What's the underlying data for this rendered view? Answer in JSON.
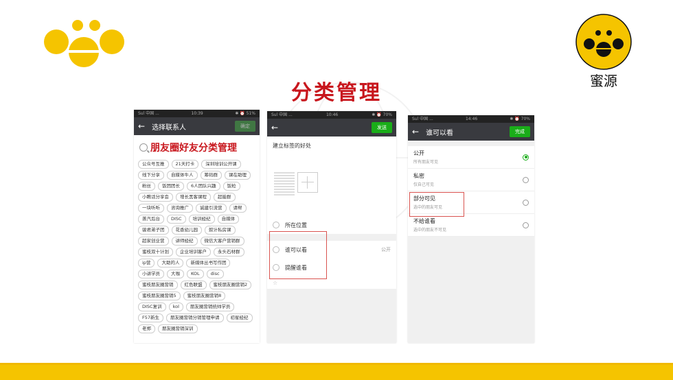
{
  "brand": {
    "name": "蜜源",
    "accent": "#f5c400",
    "title_color": "#c8161d"
  },
  "slide_title": "分类管理",
  "phone1": {
    "status_left": "Sul 中国 ...",
    "status_time": "10:39",
    "status_right": "✱ ⏰ 51%",
    "nav_title": "选择联系人",
    "nav_button": "确定",
    "search_title": "朋友圈好友分类管理",
    "tags": [
      "公众号互推",
      "21天打卡",
      "深圳培训公开课",
      "线下分享",
      "自媒体牛人",
      "筹码群",
      "课在助理",
      "粉丝",
      "饭团团长",
      "6人团队兴趣",
      "饭粒",
      "小瞧话分享会",
      "增长黑客课程",
      "超能群",
      "一块听听",
      "咨询推广",
      "诚建引流营",
      "请帮",
      "蒸汽后台",
      "DISC",
      "培训经纪",
      "自媒体",
      "骏君弟子团",
      "花香幼儿园",
      "奴计私房课",
      "超家创业营",
      "讲师经纪",
      "微信大客户营销群",
      "蜜枝双十计划",
      "企业培训客户",
      "永头石材群",
      "ip营",
      "大助的人",
      "新媒体丛书写作团",
      "小讲学员",
      "大咖",
      "KOL",
      "disc",
      "蜜枝朋友圈营销",
      "红色联盟",
      "蜜枝朋友圈营销2",
      "蜜枝朋友圈营销5",
      "蜜枝朋友圈营销8",
      "DISC复训",
      "kol",
      "朋友圈营销统帅学员",
      "F57新生",
      "朋友圈营销分销管理申请",
      "初星经纪",
      "老郑",
      "朋友圈营销深训"
    ]
  },
  "phone2": {
    "status_left": "Sul 中国 ...",
    "status_time": "10:46",
    "status_right": "✱ ⏰ 70%",
    "nav_button": "发送",
    "post_text": "建立标签的好处",
    "location": "所在位置",
    "who_can_see": "谁可以看",
    "who_can_see_value": "公开",
    "remind": "提醒谁看"
  },
  "phone3": {
    "status_left": "Sul 中国 ...",
    "status_time": "14:46",
    "status_right": "✱ ⏰ 70%",
    "nav_title": "谁可以看",
    "nav_button": "完成",
    "options": [
      {
        "title": "公开",
        "sub": "所有朋友可见"
      },
      {
        "title": "私密",
        "sub": "仅自己可见"
      },
      {
        "title": "部分可见",
        "sub": "选中的朋友可见"
      },
      {
        "title": "不给谁看",
        "sub": "选中的朋友不可见"
      }
    ]
  }
}
